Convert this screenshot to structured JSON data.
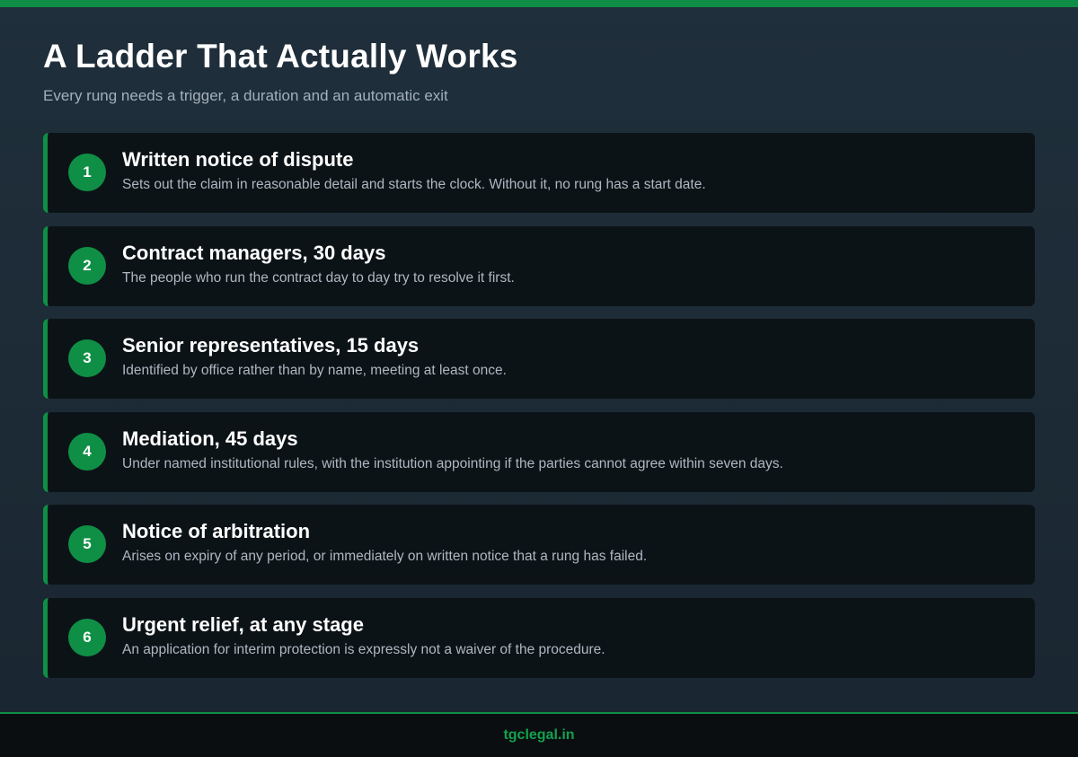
{
  "header": {
    "title": "A Ladder That Actually Works",
    "subtitle": "Every rung needs a trigger, a duration and an automatic exit"
  },
  "steps": [
    {
      "number": "1",
      "title": "Written notice of dispute",
      "description": "Sets out the claim in reasonable detail and starts the clock. Without it, no rung has a start date."
    },
    {
      "number": "2",
      "title": "Contract managers, 30 days",
      "description": "The people who run the contract day to day try to resolve it first."
    },
    {
      "number": "3",
      "title": "Senior representatives, 15 days",
      "description": "Identified by office rather than by name, meeting at least once."
    },
    {
      "number": "4",
      "title": "Mediation, 45 days",
      "description": "Under named institutional rules, with the institution appointing if the parties cannot agree within seven days."
    },
    {
      "number": "5",
      "title": "Notice of arbitration",
      "description": "Arises on expiry of any period, or immediately on written notice that a rung has failed."
    },
    {
      "number": "6",
      "title": "Urgent relief, at any stage",
      "description": "An application for interim protection is expressly not a waiver of the procedure."
    }
  ],
  "footer": {
    "site": "tgclegal.in"
  },
  "colors": {
    "accent": "#0f8f45",
    "background": "#1f2f3b",
    "card": "#0c1317"
  }
}
